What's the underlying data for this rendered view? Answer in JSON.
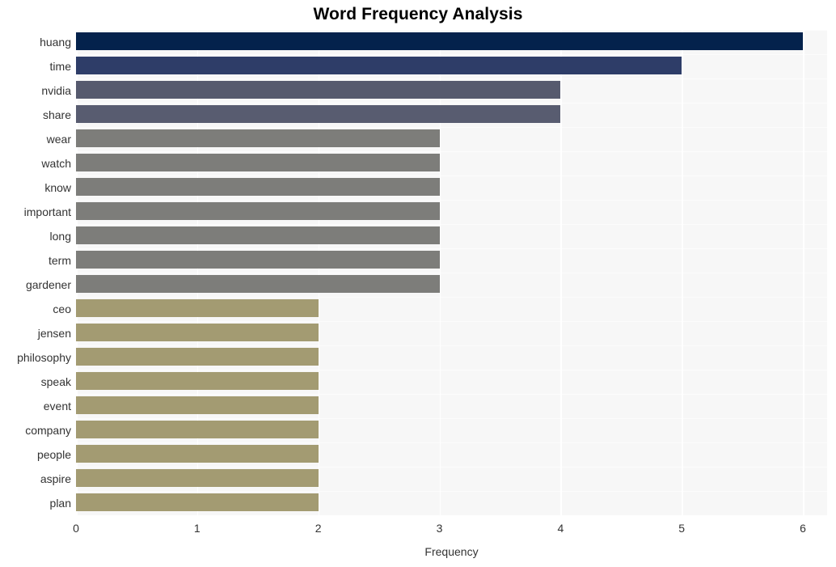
{
  "chart_data": {
    "type": "bar",
    "orientation": "horizontal",
    "title": "Word Frequency Analysis",
    "xlabel": "Frequency",
    "ylabel": "",
    "xlim": [
      0,
      6.2
    ],
    "xticks": [
      "0",
      "1",
      "2",
      "3",
      "4",
      "5",
      "6"
    ],
    "xtick_values": [
      0,
      1,
      2,
      3,
      4,
      5,
      6
    ],
    "grid": true,
    "legend": null,
    "categories": [
      "huang",
      "time",
      "nvidia",
      "share",
      "wear",
      "watch",
      "know",
      "important",
      "long",
      "term",
      "gardener",
      "ceo",
      "jensen",
      "philosophy",
      "speak",
      "event",
      "company",
      "people",
      "aspire",
      "plan"
    ],
    "values": [
      6,
      5,
      4,
      4,
      3,
      3,
      3,
      3,
      3,
      3,
      3,
      2,
      2,
      2,
      2,
      2,
      2,
      2,
      2,
      2
    ],
    "bar_colors": [
      "#04224c",
      "#2e3d६8",
      "#565a6e",
      "#585c70",
      "#7d7d7a",
      "#7d7d7a",
      "#7d7d7a",
      "#7d7d7a",
      "#7d7d7a",
      "#7d7d7a",
      "#7d7d7a",
      "#a39b72",
      "#a39b72",
      "#a39b72",
      "#a39b72",
      "#a39b72",
      "#a39b72",
      "#a39b72",
      "#a39b72",
      "#a39b72"
    ]
  },
  "colors": {
    "figure_background": "#ffffff",
    "plot_background": "#f7f7f7",
    "gridline": "#ffffff",
    "title_text": "#000000",
    "tick_text": "#333333",
    "bar_rank1": "#04224c",
    "bar_rank2": "#2e3d68",
    "bar_rank3": "#565a6e",
    "bar_rank4": "#585c70",
    "bar_gray": "#7d7d7a",
    "bar_khaki": "#a39b72"
  }
}
